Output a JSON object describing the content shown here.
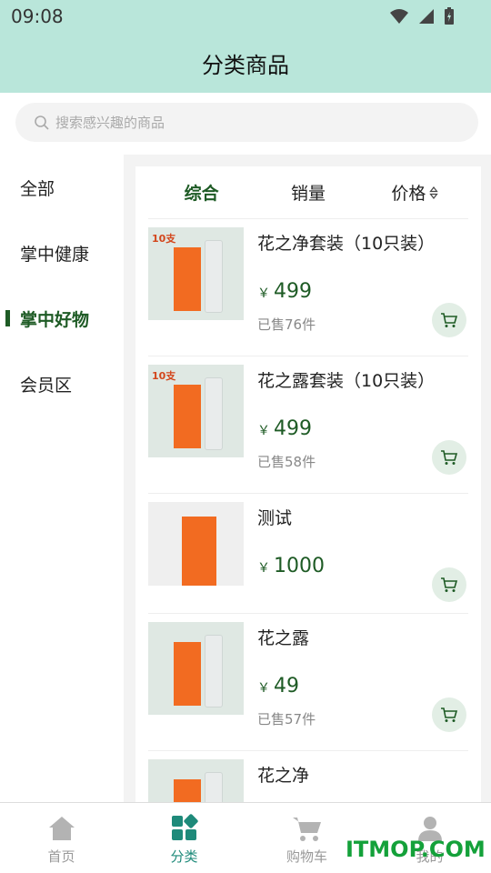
{
  "status_bar": {
    "time": "09:08"
  },
  "header": {
    "title": "分类商品"
  },
  "search": {
    "placeholder": "搜索感兴趣的商品"
  },
  "sidebar": {
    "items": [
      {
        "label": "全部",
        "active": false
      },
      {
        "label": "掌中健康",
        "active": false
      },
      {
        "label": "掌中好物",
        "active": true
      },
      {
        "label": "会员区",
        "active": false
      }
    ]
  },
  "sort": {
    "tabs": [
      {
        "label": "综合",
        "active": true
      },
      {
        "label": "销量",
        "active": false
      },
      {
        "label": "价格",
        "active": false
      }
    ]
  },
  "products": [
    {
      "name": "花之净套装（10只装）",
      "currency": "￥",
      "price": "499",
      "sold": "已售76件",
      "image_badge": "10支"
    },
    {
      "name": "花之露套装（10只装）",
      "currency": "￥",
      "price": "499",
      "sold": "已售58件",
      "image_badge": "10支"
    },
    {
      "name": "测试",
      "currency": "￥",
      "price": "1000",
      "sold": "",
      "image_badge": ""
    },
    {
      "name": "花之露",
      "currency": "￥",
      "price": "49",
      "sold": "已售57件",
      "image_badge": ""
    },
    {
      "name": "花之净",
      "currency": "",
      "price": "",
      "sold": "",
      "image_badge": ""
    }
  ],
  "tabbar": {
    "items": [
      {
        "label": "首页",
        "icon": "home-icon",
        "active": false
      },
      {
        "label": "分类",
        "icon": "category-icon",
        "active": true
      },
      {
        "label": "购物车",
        "icon": "cart-icon",
        "active": false
      },
      {
        "label": "我的",
        "icon": "user-icon",
        "active": false
      }
    ]
  },
  "watermark": "ITMOP.COM",
  "colors": {
    "header": "#b9e6da",
    "accent": "#1e5b25",
    "tab_active": "#1e8a7a",
    "product_orange": "#f26b21"
  }
}
